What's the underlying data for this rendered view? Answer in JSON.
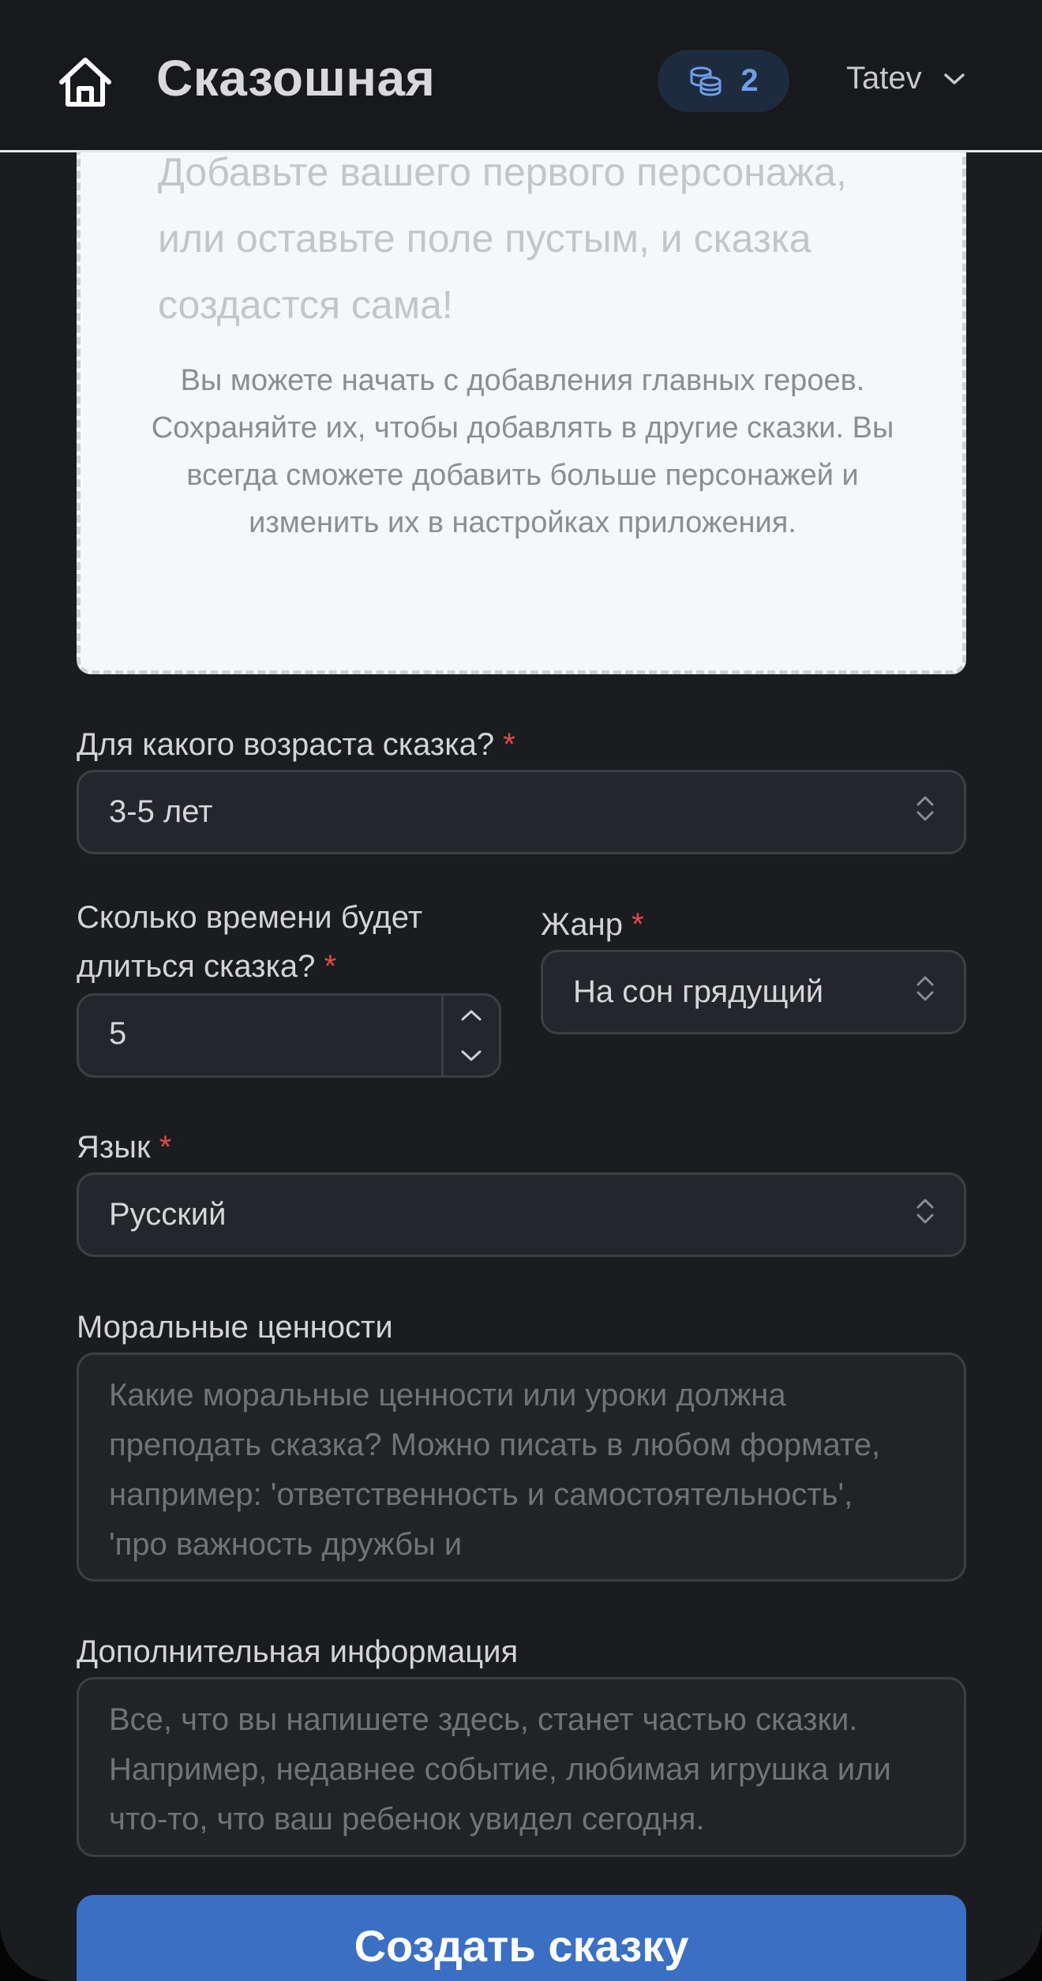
{
  "header": {
    "brand": "Сказошная",
    "credits": "2",
    "user_name": "Tatev"
  },
  "empty_characters": {
    "title": "Добавьте вашего первого персонажа, или оставьте поле пустым, и сказка создастся сама!",
    "description": "Вы можете начать с добавления главных героев. Сохраняйте их, чтобы добавлять в другие сказки. Вы всегда сможете добавить больше персонажей и изменить их в настройках приложения."
  },
  "form": {
    "required_mark": "*",
    "age": {
      "label": "Для какого возраста сказка?",
      "value": "3-5 лет"
    },
    "duration": {
      "label": "Сколько времени будет длиться сказка?",
      "value": "5"
    },
    "genre": {
      "label": "Жанр",
      "value": "На сон грядущий"
    },
    "language": {
      "label": "Язык",
      "value": "Русский"
    },
    "morals": {
      "label": "Моральные ценности",
      "placeholder": "Какие моральные ценности или уроки должна преподать сказка? Можно писать в любом формате, например: 'ответственность и самостоятельность', 'про важность дружбы и"
    },
    "extra_info": {
      "label": "Дополнительная информация",
      "placeholder": "Все, что вы напишете здесь, станет частью сказки. Например, недавнее событие, любимая игрушка или что-то, что ваш ребенок увидел сегодня."
    },
    "submit_label": "Создать сказку"
  },
  "colors": {
    "accent": "#3a6fc4",
    "required": "#e54848",
    "credits_text": "#6d9ee6"
  }
}
